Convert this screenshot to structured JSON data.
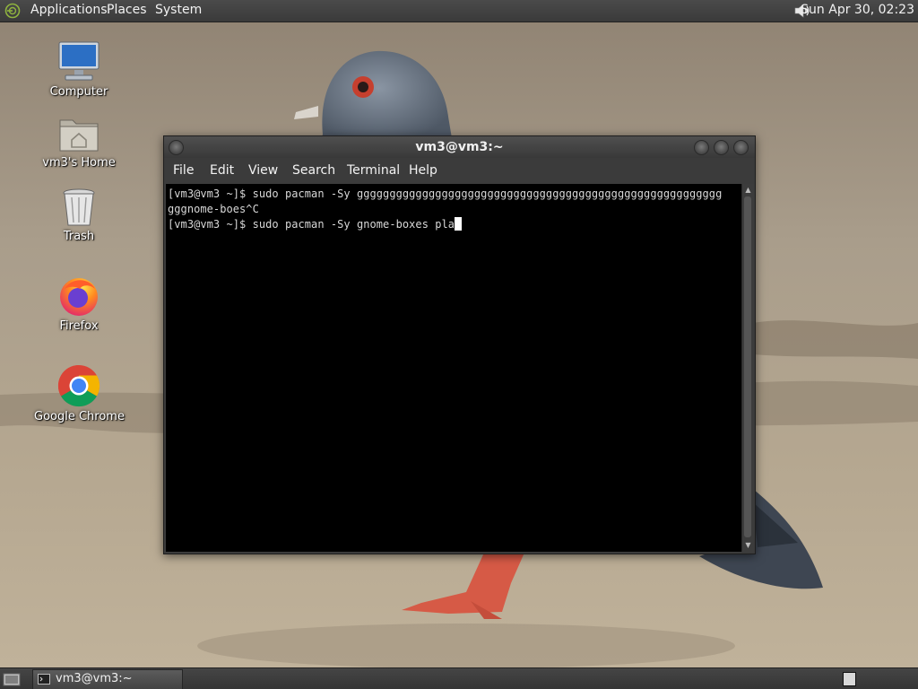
{
  "top_panel": {
    "menus": [
      "Applications",
      "Places",
      "System"
    ],
    "clock": "Sun Apr 30, 02:23",
    "icons": [
      "distro-logo-icon",
      "volume-icon"
    ]
  },
  "desktop": {
    "icons": [
      {
        "label": "Computer",
        "icon": "computer-icon"
      },
      {
        "label": "vm3's Home",
        "icon": "home-folder-icon"
      },
      {
        "label": "Trash",
        "icon": "trash-icon"
      },
      {
        "label": "Firefox",
        "icon": "firefox-icon"
      },
      {
        "label": "Google Chrome",
        "icon": "chrome-icon"
      }
    ]
  },
  "terminal": {
    "title": "vm3@vm3:~",
    "menus": [
      "File",
      "Edit",
      "View",
      "Search",
      "Terminal",
      "Help"
    ],
    "lines": [
      "[vm3@vm3 ~]$ sudo pacman -Sy gggggggggggggggggggggggggggggggggggggggggggggggggggggggg",
      "gggnome-boes^C",
      "[vm3@vm3 ~]$ sudo pacman -Sy gnome-boxes pla"
    ]
  },
  "taskbar": {
    "window_button": "vm3@vm3:~"
  },
  "colors": {
    "panel": "#3f3f3f",
    "terminal_bg": "#000000",
    "terminal_fg": "#d8d8d8"
  }
}
